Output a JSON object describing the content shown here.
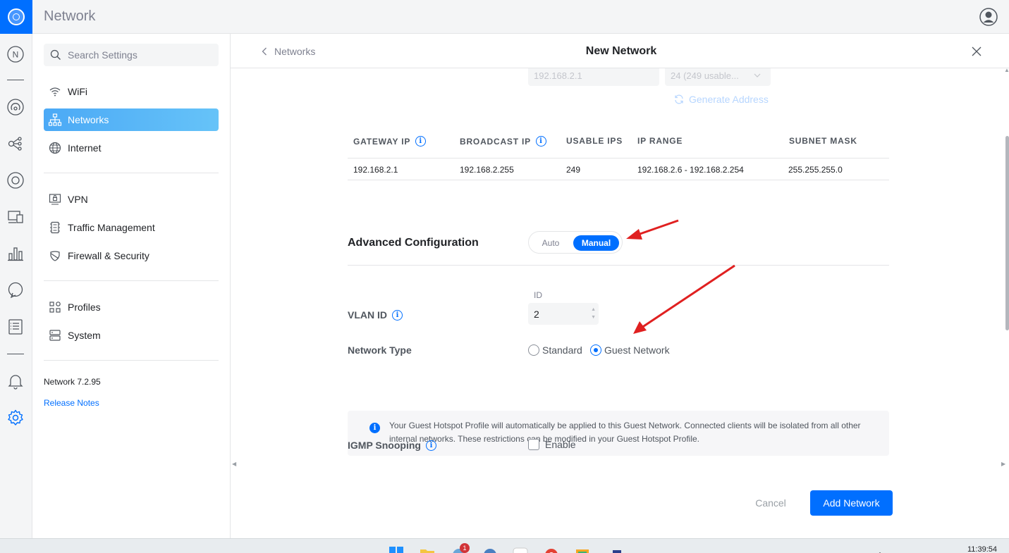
{
  "app": {
    "title": "Network"
  },
  "rail": {
    "icons": [
      "network-badge-icon",
      "topology-icon",
      "clients-icon",
      "ports-icon",
      "devices-icon",
      "statistics-icon",
      "insights-icon",
      "logs-icon",
      "notifications-icon",
      "settings-icon"
    ],
    "badge_letter": "N"
  },
  "settings_nav": {
    "search_placeholder": "Search Settings",
    "items": [
      {
        "label": "WiFi",
        "icon": "wifi-icon"
      },
      {
        "label": "Networks",
        "icon": "networks-icon",
        "active": true
      },
      {
        "label": "Internet",
        "icon": "globe-icon"
      },
      {
        "label": "VPN",
        "icon": "vpn-icon"
      },
      {
        "label": "Traffic Management",
        "icon": "traffic-icon"
      },
      {
        "label": "Firewall & Security",
        "icon": "shield-icon"
      },
      {
        "label": "Profiles",
        "icon": "profiles-icon"
      },
      {
        "label": "System",
        "icon": "system-icon"
      }
    ],
    "version": "Network 7.2.95",
    "release_notes": "Release Notes"
  },
  "panel": {
    "back_label": "Networks",
    "title": "New Network",
    "faded_gateway": "192.168.2.1",
    "faded_mask": "24 (249 usable...",
    "generate_address": "Generate Address",
    "table": {
      "headers": [
        "GATEWAY IP",
        "BROADCAST IP",
        "USABLE IPS",
        "IP RANGE",
        "SUBNET MASK"
      ],
      "row": [
        "192.168.2.1",
        "192.168.2.255",
        "249",
        "192.168.2.6 - 192.168.2.254",
        "255.255.255.0"
      ]
    },
    "advanced": {
      "title": "Advanced Configuration",
      "options": [
        "Auto",
        "Manual"
      ],
      "selected": "Manual"
    },
    "vlan": {
      "label": "VLAN ID",
      "caption": "ID",
      "value": "2"
    },
    "network_type": {
      "label": "Network Type",
      "options": [
        "Standard",
        "Guest Network"
      ],
      "selected": "Guest Network"
    },
    "notice": "Your Guest Hotspot Profile will automatically be applied to this Guest Network. Connected clients will be isolated from all other internal networks. These restrictions can be modified in your Guest Hotspot Profile.",
    "igmp": {
      "label": "IGMP Snooping",
      "checkbox_label": "Enable",
      "checked": false
    },
    "cancel": "Cancel",
    "submit": "Add Network"
  },
  "taskbar": {
    "clock": "11:39:54",
    "badge_count": "1"
  },
  "colors": {
    "accent": "#006fff",
    "active_nav": "#5dbcf7",
    "annotation_arrow": "#e02020"
  }
}
